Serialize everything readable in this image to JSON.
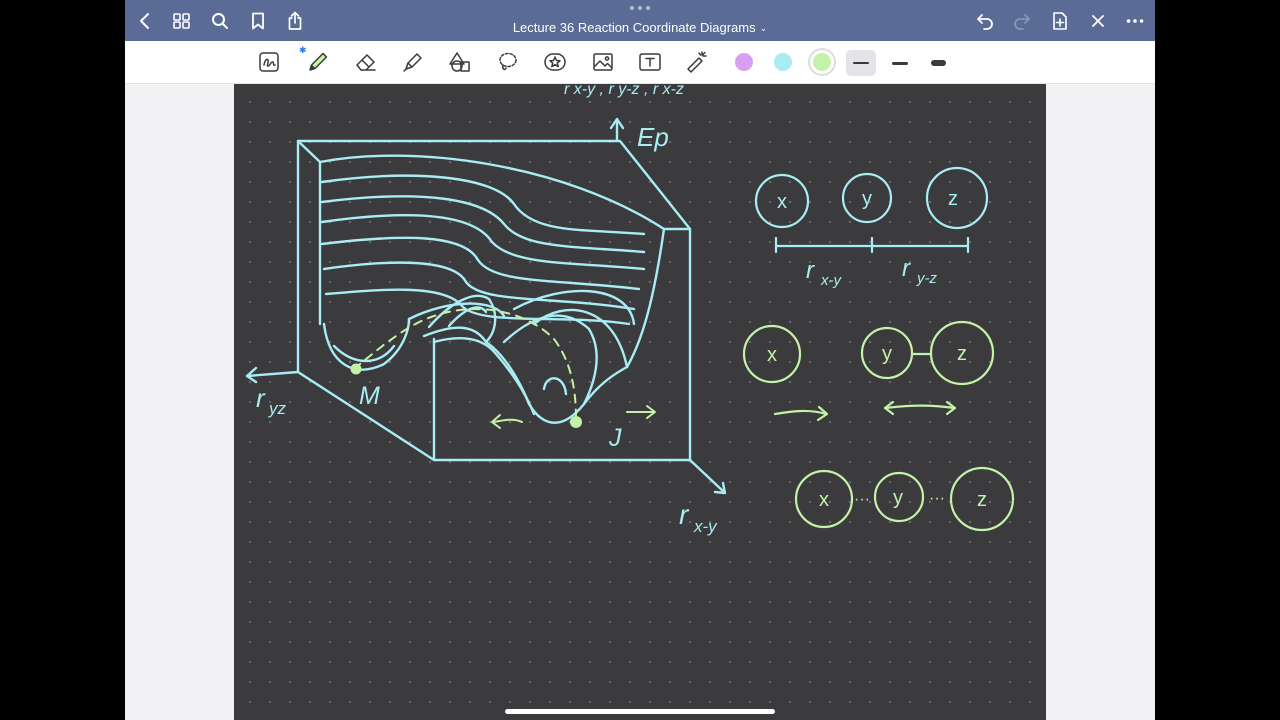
{
  "titlebar": {
    "document_title": "Lecture 36 Reaction Coordinate Diagrams",
    "title_chevron": "⌄",
    "left_icons": [
      "chevron-left-icon",
      "grid-icon",
      "search-icon",
      "bookmark-icon",
      "share-icon"
    ],
    "right_icons": [
      "undo-icon",
      "redo-icon",
      "add-page-icon",
      "close-icon",
      "more-icon"
    ]
  },
  "toolbar": {
    "tools": [
      "scribble-icon",
      "pen-icon",
      "eraser-icon",
      "highlighter-icon",
      "shapes-icon",
      "lasso-icon",
      "sticker-icon",
      "image-icon",
      "text-icon",
      "laser-pointer-icon"
    ],
    "active_tool": "pen",
    "colors": [
      {
        "name": "purple",
        "hex": "#d8a0f0"
      },
      {
        "name": "cyan",
        "hex": "#a8ecf4"
      },
      {
        "name": "light-green",
        "hex": "#c4f2a8",
        "selected": true
      }
    ],
    "stroke_widths": [
      "thin",
      "medium",
      "thick"
    ],
    "selected_stroke": "thin"
  },
  "page": {
    "background": "#3b3b3d",
    "ink_cyan": "#a8ecf4",
    "ink_green": "#c4f2a8",
    "top_partial_text": "r x-y ,  r y-z ,  r x-z",
    "surface_labels": {
      "energy_axis": "Ep",
      "axis_left": "r",
      "axis_left_sub": "yz",
      "axis_right": "r",
      "axis_right_sub": "x-y",
      "min_left": "M",
      "min_right": "J"
    },
    "atoms_row1": [
      "x",
      "y",
      "z"
    ],
    "distance_labels": {
      "xy": "r",
      "xy_sub": "x-y",
      "yz": "r",
      "yz_sub": "y-z"
    },
    "atoms_row2": [
      "x",
      "y",
      "z"
    ],
    "atoms_row3": [
      "x",
      "y",
      "z"
    ],
    "bond_dots": "···"
  }
}
